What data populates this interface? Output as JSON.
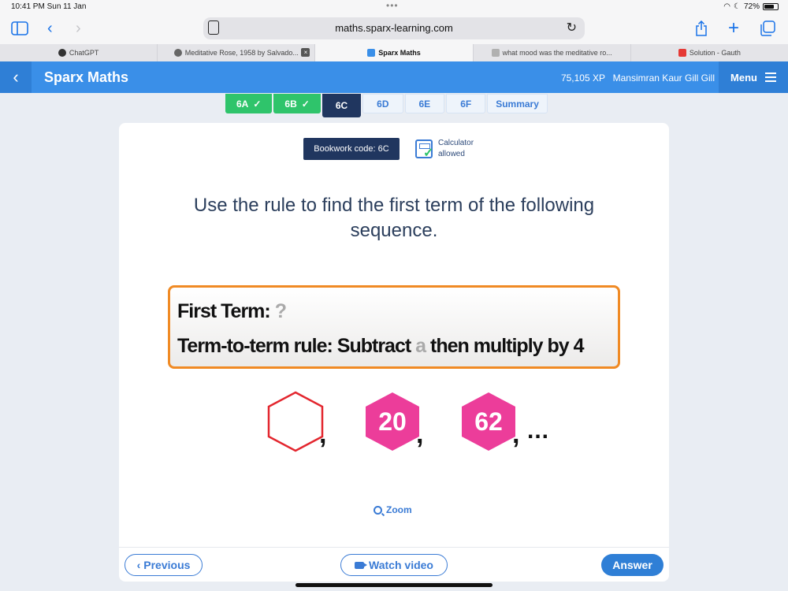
{
  "status_bar": {
    "time": "10:41 PM  Sun 11 Jan",
    "battery": "72%"
  },
  "browser": {
    "url": "maths.sparx-learning.com",
    "tabs": [
      {
        "label": "ChatGPT",
        "active": false,
        "favicon_color": "#333333"
      },
      {
        "label": "Meditative Rose, 1958 by Salvado...",
        "active": false,
        "favicon_color": "#666666",
        "has_close": true
      },
      {
        "label": "Sparx Maths",
        "active": true,
        "favicon_color": "#3a8fe8"
      },
      {
        "label": "what mood was the meditative ro...",
        "active": false,
        "favicon_color": "#b0b0b0"
      },
      {
        "label": "Solution - Gauth",
        "active": false,
        "favicon_color": "#e53935"
      }
    ]
  },
  "header": {
    "brand": "Sparx Maths",
    "xp": "75,105 XP",
    "user": "Mansimran Kaur Gill Gill",
    "menu_label": "Menu"
  },
  "task_tabs": [
    {
      "label": "6A",
      "state": "done"
    },
    {
      "label": "6B",
      "state": "done"
    },
    {
      "label": "6C",
      "state": "current"
    },
    {
      "label": "6D",
      "state": "pending"
    },
    {
      "label": "6E",
      "state": "pending"
    },
    {
      "label": "6F",
      "state": "pending"
    },
    {
      "label": "Summary",
      "state": "pending"
    }
  ],
  "question": {
    "bookwork": "Bookwork code: 6C",
    "calculator_line1": "Calculator",
    "calculator_line2": "allowed",
    "text": "Use the rule to find the first term of the following sequence.",
    "first_term_label": "First Term:",
    "first_term_value": "?",
    "rule_label": "Term-to-term rule: Subtract",
    "rule_var": "a",
    "rule_tail": "then multiply by 4",
    "sequence": [
      "",
      "20",
      "62"
    ],
    "ellipsis": "..."
  },
  "zoom_label": "Zoom",
  "footer": {
    "previous": "Previous",
    "watch_video": "Watch video",
    "answer": "Answer"
  },
  "colors": {
    "brand_blue": "#3a8fe8",
    "navy": "#20365f",
    "done_green": "#2fc46b",
    "hex_pink": "#ec3d9a",
    "rule_border": "#f08a24",
    "empty_hex": "#e3262e"
  }
}
